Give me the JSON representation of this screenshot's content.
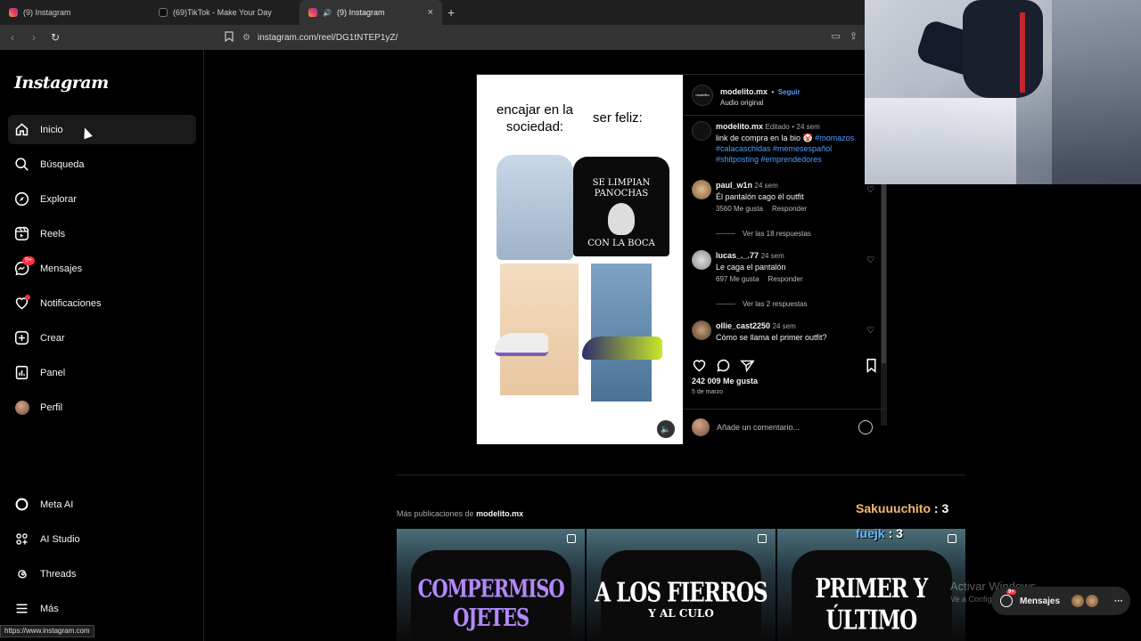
{
  "browser": {
    "tabs": [
      {
        "title": "(9) Instagram",
        "icon": "instagram-icon"
      },
      {
        "title": "(69)TikTok - Make Your Day",
        "icon": "tiktok-icon"
      },
      {
        "title": "(9) Instagram",
        "icon": "instagram-icon",
        "active": true
      }
    ],
    "close_label": "×",
    "new_tab_label": "+",
    "url": "instagram.com/reel/DG1tNTEP1yZ/",
    "status_url": "https://www.instagram.com"
  },
  "sidebar": {
    "logo": "Instagram",
    "items": [
      {
        "label": "Inicio",
        "icon": "home-icon"
      },
      {
        "label": "Búsqueda",
        "icon": "search-icon"
      },
      {
        "label": "Explorar",
        "icon": "compass-icon"
      },
      {
        "label": "Reels",
        "icon": "reels-icon"
      },
      {
        "label": "Mensajes",
        "icon": "messenger-icon",
        "badge": "9+"
      },
      {
        "label": "Notificaciones",
        "icon": "heart-icon"
      },
      {
        "label": "Crear",
        "icon": "plus-square-icon"
      },
      {
        "label": "Panel",
        "icon": "dashboard-icon"
      },
      {
        "label": "Perfil",
        "icon": "avatar"
      }
    ],
    "bottom_items": [
      {
        "label": "Meta AI",
        "icon": "meta-ai-icon"
      },
      {
        "label": "AI Studio",
        "icon": "ai-studio-icon"
      },
      {
        "label": "Threads",
        "icon": "threads-icon"
      },
      {
        "label": "Más",
        "icon": "menu-icon"
      }
    ]
  },
  "post": {
    "image": {
      "left_caption": "encajar en la sociedad:",
      "right_caption": "ser feliz:",
      "shirt_text_top": "SE LIMPIAN PANOCHAS",
      "shirt_text_bottom": "CON LA BOCA"
    },
    "author": "modelito.mx",
    "follow": "Seguir",
    "audio": "Audio original",
    "caption": {
      "user": "modelito.mx",
      "edited": "Editado",
      "time": "24 sem",
      "text": "link de compra en la bio 🤡",
      "hashtags": "#momazos #calacaschidas #memesespañol #shitposting #emprendedores"
    },
    "comments": [
      {
        "user": "paul_w1n",
        "time": "24 sem",
        "text": "Él pantalón cago él outfit",
        "likes": "3560 Me gusta",
        "reply": "Responder",
        "replies": "Ver las 18 respuestas"
      },
      {
        "user": "lucas_._.77",
        "time": "24 sem",
        "text": "Le caga el pantalón",
        "likes": "697 Me gusta",
        "reply": "Responder",
        "replies": "Ver las 2 respuestas"
      },
      {
        "user": "ollie_cast2250",
        "time": "24 sem",
        "text": "Cómo se llama el primer outfit?"
      }
    ],
    "likes": "242 009 Me gusta",
    "date": "5 de marzo",
    "add_comment": "Añade un comentario..."
  },
  "more": {
    "label": "Más publicaciones de",
    "user": "modelito.mx",
    "thumbs": [
      {
        "title": "COMPERMISO OJETES",
        "sub": ""
      },
      {
        "title": "A LOS FIERROS",
        "sub": "Y AL CULO"
      },
      {
        "title": "PRIMER Y ÚLTIMO",
        "sub": ""
      }
    ]
  },
  "overlay": {
    "chat": [
      {
        "name": "Sakuuuchito",
        "count": ": 3"
      },
      {
        "name": "fuejk",
        "count": ": 3"
      }
    ],
    "watermark": "Activar Windows",
    "watermark_sub": "Ve a Configuración para activar Windows.",
    "messages_pill": {
      "label": "Mensajes",
      "badge": "9+",
      "more": "···"
    }
  },
  "colors": {
    "accent": "#4f9eff",
    "badge": "#ff3040",
    "chat_name_1": "#f5b971",
    "chat_name_2": "#6ab6ff"
  }
}
